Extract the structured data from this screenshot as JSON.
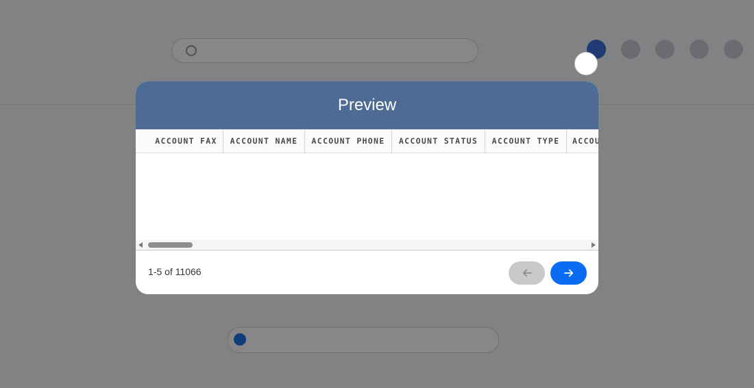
{
  "modal": {
    "title": "Preview",
    "columns": [
      "ACCOUNT FAX",
      "ACCOUNT NAME",
      "ACCOUNT PHONE",
      "ACCOUNT STATUS",
      "ACCOUNT TYPE",
      "ACCOU"
    ],
    "rows": [],
    "pagination": {
      "range_text": "1-5 of 11066",
      "prev_enabled": false,
      "next_enabled": true
    },
    "icons": {
      "prev": "arrow-left-icon",
      "next": "arrow-right-icon",
      "close": "close-icon"
    },
    "colors": {
      "header_bg": "#4d6b94",
      "next_button": "#0a6cf2",
      "prev_button_disabled": "#c9c9c9"
    }
  }
}
